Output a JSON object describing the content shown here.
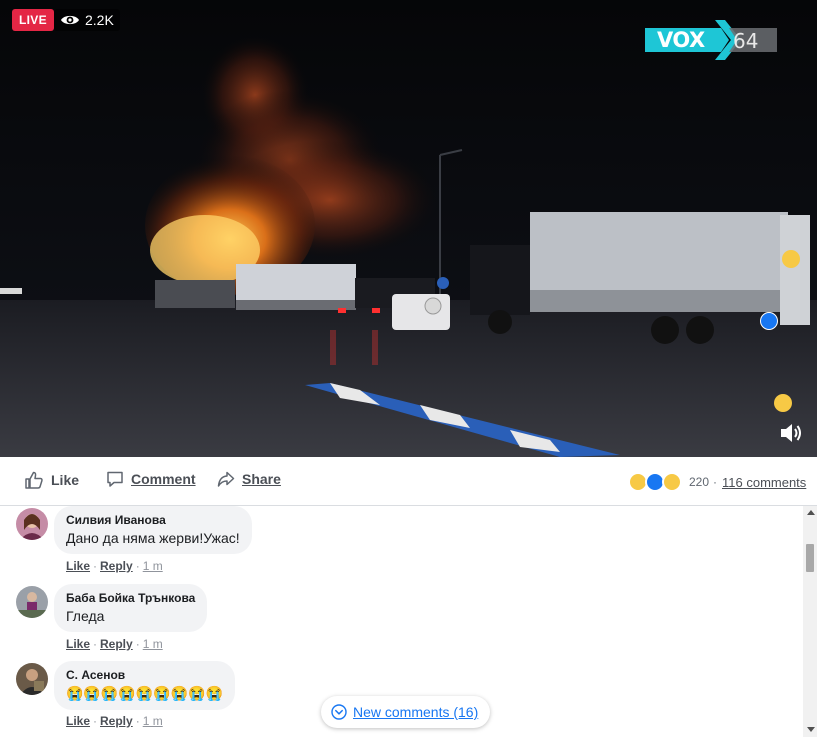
{
  "video": {
    "live_label": "LIVE",
    "viewer_count": "2.2K",
    "logo": {
      "brand": "VOX",
      "number": "64"
    }
  },
  "actions": {
    "like_label": "Like",
    "comment_label": "Comment",
    "share_label": "Share"
  },
  "stats": {
    "reaction_count": "220",
    "separator": "·",
    "comment_count": "116 comments"
  },
  "comments": [
    {
      "author": "Силвия Иванова",
      "text": "Дано да няма жерви!Ужас!",
      "like_label": "Like",
      "reply_label": "Reply",
      "time": "1 m"
    },
    {
      "author": "Баба Бойка Трънкова",
      "text": "Гледа",
      "like_label": "Like",
      "reply_label": "Reply",
      "time": "1 m"
    },
    {
      "author": "С. Асенов",
      "text": "😭😭😭😭😭😭😭😭😭",
      "like_label": "Like",
      "reply_label": "Reply",
      "time": "1 m"
    }
  ],
  "new_comments_label": "New comments (16)",
  "colors": {
    "live_red": "#e42645",
    "link_blue": "#1877f2",
    "bubble_gray": "#f2f3f5",
    "logo_cyan": "#1ec6d6"
  }
}
